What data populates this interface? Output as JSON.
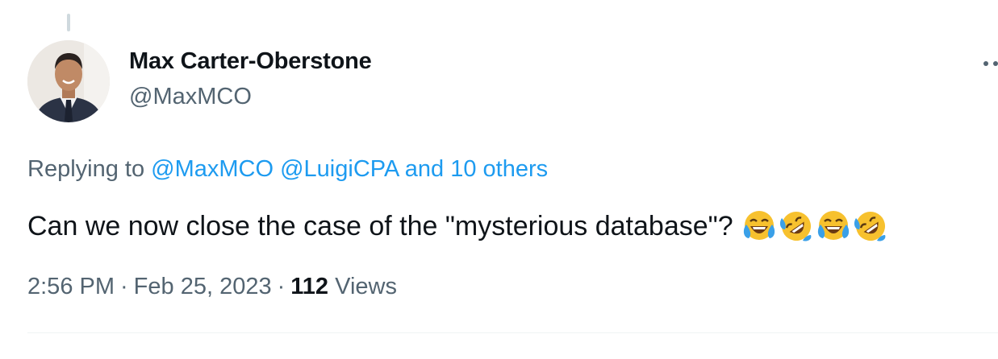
{
  "tweet": {
    "author": {
      "name": "Max Carter-Oberstone",
      "handle": "@MaxMCO",
      "avatar_icon": "person-avatar"
    },
    "reply": {
      "prefix": "Replying to",
      "mentions": [
        "@MaxMCO",
        "@LuigiCPA"
      ],
      "others": "and 10 others"
    },
    "text": "Can we now close the case of the \"mysterious database\"?",
    "emojis": [
      "face-with-tears-of-joy",
      "rolling-on-the-floor-laughing",
      "face-with-tears-of-joy",
      "rolling-on-the-floor-laughing"
    ],
    "meta": {
      "time": "2:56 PM",
      "separator": "·",
      "date": "Feb 25, 2023",
      "views_count": "112",
      "views_label": "Views"
    }
  },
  "colors": {
    "text_primary": "#0f1419",
    "text_secondary": "#536471",
    "link": "#1d9bf0",
    "divider": "#eff3f4"
  }
}
